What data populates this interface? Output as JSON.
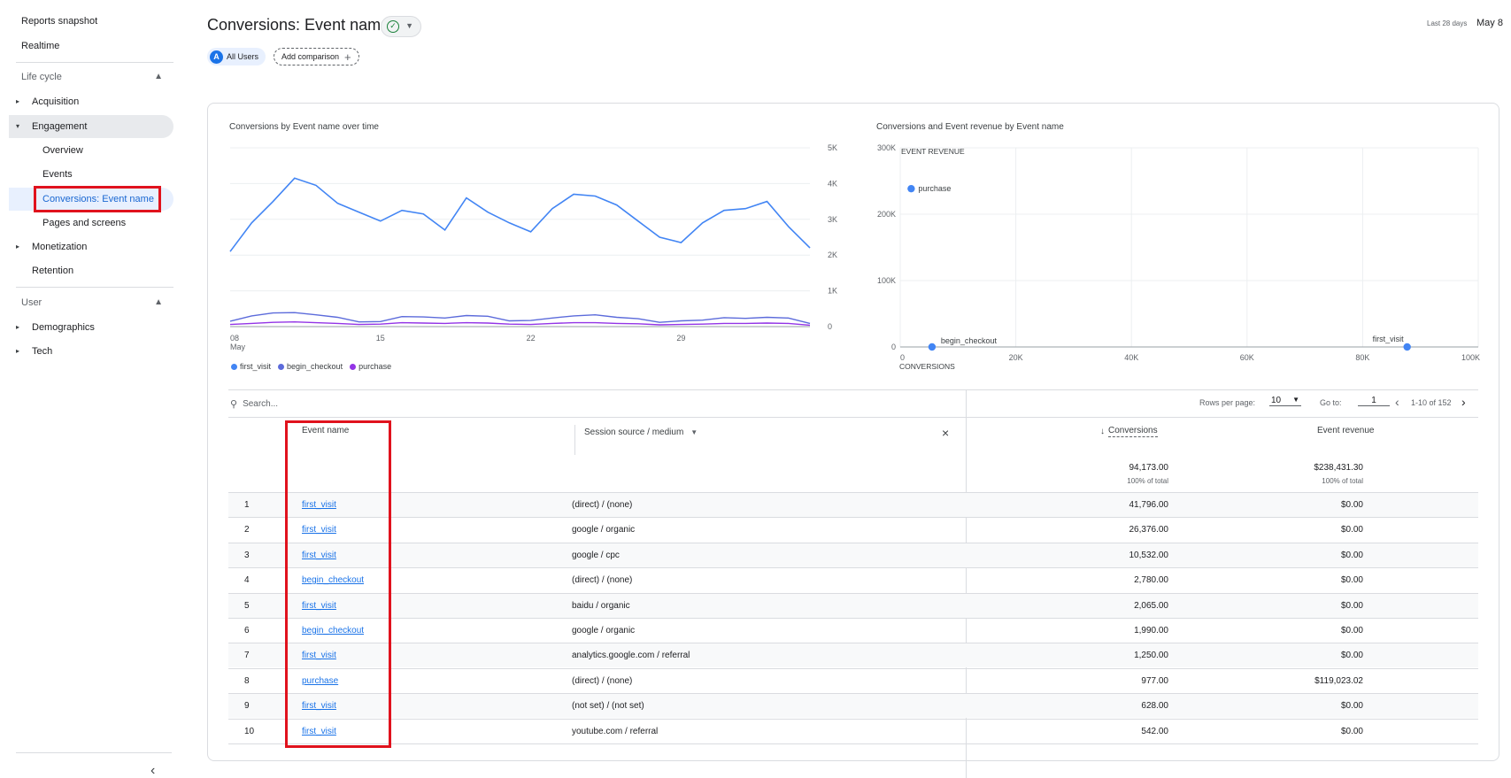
{
  "sidebar": {
    "reports_snapshot": "Reports snapshot",
    "realtime": "Realtime",
    "lifecycle_label": "Life cycle",
    "acquisition": "Acquisition",
    "engagement": "Engagement",
    "overview": "Overview",
    "events": "Events",
    "conversions": "Conversions: Event name",
    "pages_screens": "Pages and screens",
    "monetization": "Monetization",
    "retention": "Retention",
    "user_label": "User",
    "demographics": "Demographics",
    "tech": "Tech"
  },
  "header": {
    "title": "Conversions: Event name",
    "date_label": "Last 28 days",
    "date_value": "May 8",
    "segment_avatar": "A",
    "segment_label": "All Users",
    "add_comparison": "Add comparison"
  },
  "line_chart": {
    "title": "Conversions by Event name over time",
    "y_ticks": [
      "5K",
      "4K",
      "3K",
      "2K",
      "1K",
      "0"
    ],
    "x_ticks": [
      "08",
      "15",
      "22",
      "29"
    ],
    "x_sub": "May",
    "legend": [
      {
        "name": "first_visit",
        "color": "#4285f4"
      },
      {
        "name": "begin_checkout",
        "color": "#5c6bdb"
      },
      {
        "name": "purchase",
        "color": "#9334e6"
      }
    ]
  },
  "scatter_chart": {
    "title": "Conversions and Event revenue by Event name",
    "y_axis_title": "EVENT REVENUE",
    "x_axis_title": "CONVERSIONS",
    "y_ticks": [
      "300K",
      "200K",
      "100K",
      "0"
    ],
    "x_ticks": [
      "0",
      "20K",
      "40K",
      "60K",
      "80K",
      "100K"
    ],
    "points": [
      "purchase",
      "begin_checkout",
      "first_visit"
    ]
  },
  "table": {
    "search_placeholder": "Search...",
    "rows_per_page_label": "Rows per page:",
    "rows_per_page": "10",
    "goto_label": "Go to:",
    "goto_value": "1",
    "range": "1-10 of 152",
    "col_event": "Event name",
    "col_source": "Session source / medium",
    "col_conversions": "Conversions",
    "col_revenue": "Event revenue",
    "total_conversions": "94,173.00",
    "total_conversions_sub": "100% of total",
    "total_revenue": "$238,431.30",
    "total_revenue_sub": "100% of total",
    "rows": [
      {
        "n": "1",
        "event": "first_visit",
        "source": "(direct) / (none)",
        "conv": "41,796.00",
        "rev": "$0.00"
      },
      {
        "n": "2",
        "event": "first_visit",
        "source": "google / organic",
        "conv": "26,376.00",
        "rev": "$0.00"
      },
      {
        "n": "3",
        "event": "first_visit",
        "source": "google / cpc",
        "conv": "10,532.00",
        "rev": "$0.00"
      },
      {
        "n": "4",
        "event": "begin_checkout",
        "source": "(direct) / (none)",
        "conv": "2,780.00",
        "rev": "$0.00"
      },
      {
        "n": "5",
        "event": "first_visit",
        "source": "baidu / organic",
        "conv": "2,065.00",
        "rev": "$0.00"
      },
      {
        "n": "6",
        "event": "begin_checkout",
        "source": "google / organic",
        "conv": "1,990.00",
        "rev": "$0.00"
      },
      {
        "n": "7",
        "event": "first_visit",
        "source": "analytics.google.com / referral",
        "conv": "1,250.00",
        "rev": "$0.00"
      },
      {
        "n": "8",
        "event": "purchase",
        "source": "(direct) / (none)",
        "conv": "977.00",
        "rev": "$119,023.02"
      },
      {
        "n": "9",
        "event": "first_visit",
        "source": "(not set) / (not set)",
        "conv": "628.00",
        "rev": "$0.00"
      },
      {
        "n": "10",
        "event": "first_visit",
        "source": "youtube.com / referral",
        "conv": "542.00",
        "rev": "$0.00"
      }
    ]
  },
  "chart_data": [
    {
      "type": "line",
      "title": "Conversions by Event name over time",
      "x": [
        "May 8",
        "May 9",
        "May 10",
        "May 11",
        "May 12",
        "May 13",
        "May 14",
        "May 15",
        "May 16",
        "May 17",
        "May 18",
        "May 19",
        "May 20",
        "May 21",
        "May 22",
        "May 23",
        "May 24",
        "May 25",
        "May 26",
        "May 27",
        "May 28",
        "May 29",
        "May 30",
        "May 31",
        "Jun 1",
        "Jun 2",
        "Jun 3",
        "Jun 4"
      ],
      "ylim": [
        0,
        5000
      ],
      "series": [
        {
          "name": "first_visit",
          "values": [
            2100,
            2900,
            3500,
            4150,
            3950,
            3450,
            3200,
            2950,
            3250,
            3150,
            2700,
            3600,
            3200,
            2900,
            2650,
            3300,
            3700,
            3650,
            3400,
            2950,
            2500,
            2350,
            2900,
            3250,
            3300,
            3500,
            2800,
            2200
          ]
        },
        {
          "name": "begin_checkout",
          "values": [
            150,
            300,
            380,
            390,
            330,
            260,
            130,
            140,
            280,
            270,
            240,
            310,
            290,
            160,
            170,
            240,
            300,
            330,
            260,
            220,
            120,
            160,
            180,
            250,
            230,
            260,
            240,
            90
          ]
        },
        {
          "name": "purchase",
          "values": [
            60,
            90,
            120,
            130,
            110,
            90,
            60,
            70,
            110,
            100,
            90,
            110,
            100,
            70,
            60,
            90,
            110,
            110,
            90,
            80,
            50,
            60,
            70,
            90,
            90,
            100,
            90,
            40
          ]
        }
      ],
      "legend": "bottom-left"
    },
    {
      "type": "scatter",
      "title": "Conversions and Event revenue by Event name",
      "xlabel": "CONVERSIONS",
      "ylabel": "EVENT REVENUE",
      "xlim": [
        0,
        100000
      ],
      "ylim": [
        0,
        300000
      ],
      "points": [
        {
          "label": "purchase",
          "x": 977,
          "y": 238431
        },
        {
          "label": "begin_checkout",
          "x": 5500,
          "y": 0
        },
        {
          "label": "first_visit",
          "x": 87700,
          "y": 0
        }
      ]
    }
  ]
}
